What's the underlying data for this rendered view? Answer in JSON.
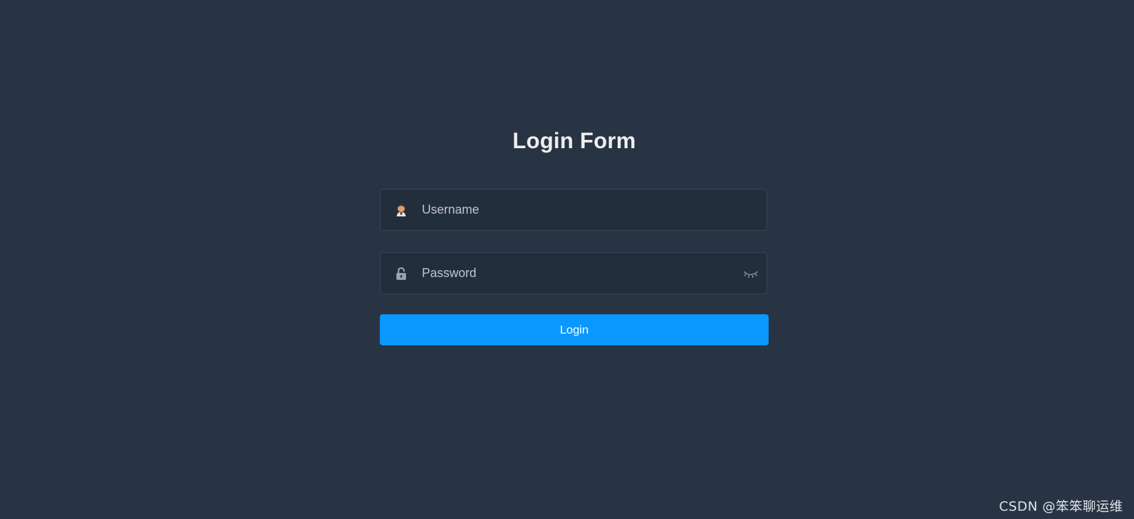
{
  "form": {
    "title": "Login Form",
    "username": {
      "placeholder": "Username",
      "value": "",
      "icon": "user-icon"
    },
    "password": {
      "placeholder": "Password",
      "value": "",
      "icon": "lock-icon",
      "toggle_icon": "eye-closed-icon"
    },
    "login_label": "Login"
  },
  "watermark": {
    "text": "CSDN @笨笨聊运维"
  },
  "colors": {
    "background": "#283443",
    "title": "#eeeeee",
    "placeholder": "#c0c4cc",
    "button": "#0a98ff",
    "button_text": "#ffffff"
  }
}
